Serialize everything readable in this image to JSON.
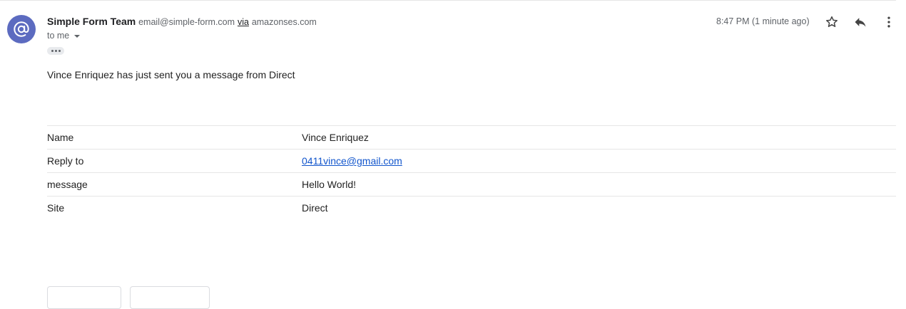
{
  "header": {
    "sender_name": "Simple Form Team",
    "sender_email": "email@simple-form.com",
    "via_label": "via",
    "via_domain": "amazonses.com",
    "recipient": "to me",
    "timestamp": "8:47 PM (1 minute ago)",
    "avatar_icon": "at-sign-icon",
    "avatar_color": "#5c6bc0"
  },
  "body": {
    "intro": "Vince Enriquez has just sent you a message from Direct",
    "fields": [
      {
        "label": "Name",
        "value": "Vince Enriquez"
      },
      {
        "label": "Reply to",
        "value": "0411vince@gmail.com"
      },
      {
        "label": "message",
        "value": "Hello World!"
      },
      {
        "label": "Site",
        "value": "Direct"
      }
    ]
  },
  "icons": {
    "star": "star-icon",
    "reply": "reply-icon",
    "more": "more-vert-icon",
    "expand": "ellipsis-icon",
    "dropdown": "caret-down-icon"
  },
  "colors": {
    "link": "#1155cc",
    "muted": "#5f6368"
  }
}
